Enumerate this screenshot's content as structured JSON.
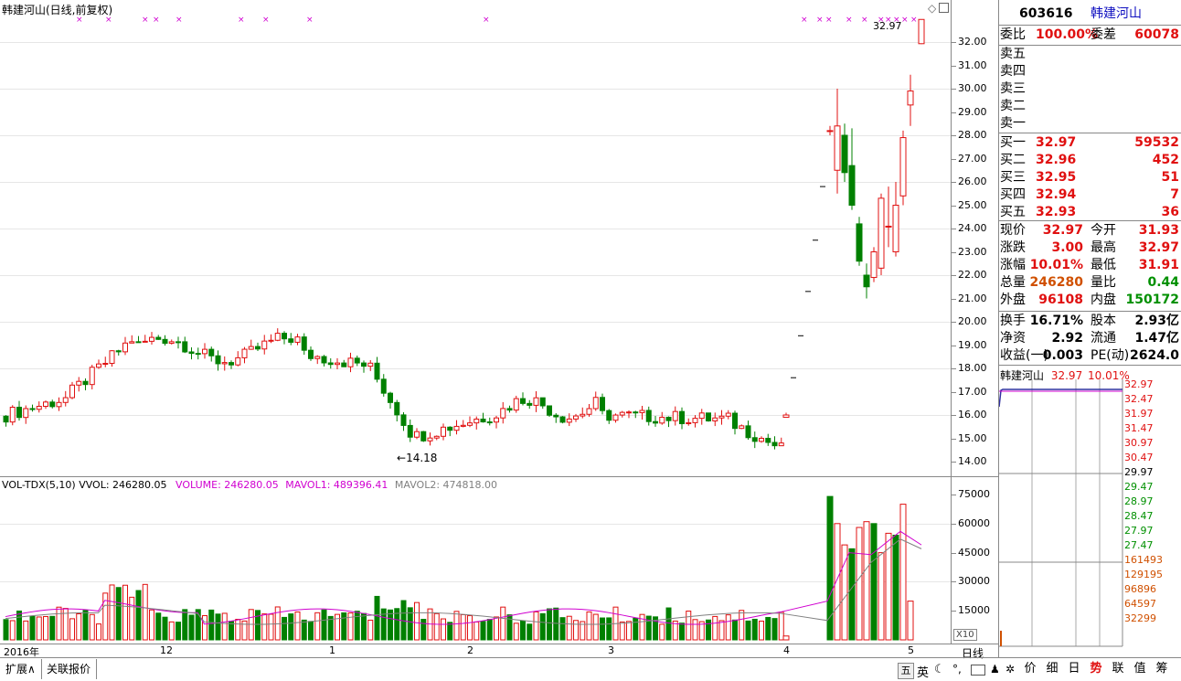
{
  "chart_header": {
    "title": "韩建河山(日线,前复权)",
    "last_price_label": "32.97",
    "low_marker": "14.18"
  },
  "price_axis": [
    "32.00",
    "31.00",
    "30.00",
    "29.00",
    "28.00",
    "27.00",
    "26.00",
    "25.00",
    "24.00",
    "23.00",
    "22.00",
    "21.00",
    "20.00",
    "19.00",
    "18.00",
    "17.00",
    "16.00",
    "15.00",
    "14.00"
  ],
  "volume_header": {
    "indicator": "VOL-TDX(5,10)",
    "vvol": "VVOL: 246280.05",
    "volume": "VOLUME: 246280.05",
    "mavol1": "MAVOL1: 489396.41",
    "mavol2": "MAVOL2: 474818.00"
  },
  "volume_axis": [
    "75000",
    "60000",
    "45000",
    "30000",
    "15000"
  ],
  "volume_unit": "X10",
  "time_axis": [
    "2016年",
    "12",
    "1",
    "2",
    "3",
    "4",
    "5"
  ],
  "period_label": "日线",
  "bottom_tabs": [
    "扩展∧",
    "关联报价"
  ],
  "quote": {
    "code": "603616",
    "name": "韩建河山",
    "weibi_label": "委比",
    "weibi_value": "100.00%",
    "weicha_label": "委差",
    "weicha_value": "60078",
    "sell_labels": [
      "卖五",
      "卖四",
      "卖三",
      "卖二",
      "卖一"
    ],
    "buy": [
      {
        "label": "买一",
        "price": "32.97",
        "vol": "59532"
      },
      {
        "label": "买二",
        "price": "32.96",
        "vol": "452"
      },
      {
        "label": "买三",
        "price": "32.95",
        "vol": "51"
      },
      {
        "label": "买四",
        "price": "32.94",
        "vol": "7"
      },
      {
        "label": "买五",
        "price": "32.93",
        "vol": "36"
      }
    ],
    "stats": [
      {
        "l1": "现价",
        "v1": "32.97",
        "l2": "今开",
        "v2": "31.93"
      },
      {
        "l1": "涨跌",
        "v1": "3.00",
        "l2": "最高",
        "v2": "32.97"
      },
      {
        "l1": "涨幅",
        "v1": "10.01%",
        "l2": "最低",
        "v2": "31.91"
      },
      {
        "l1": "总量",
        "v1": "246280",
        "l2": "量比",
        "v2": "0.44"
      },
      {
        "l1": "外盘",
        "v1": "96108",
        "l2": "内盘",
        "v2": "150172"
      }
    ],
    "stats2": [
      {
        "l1": "换手",
        "v1": "16.71%",
        "l2": "股本",
        "v2": "2.93亿"
      },
      {
        "l1": "净资",
        "v1": "2.92",
        "l2": "流通",
        "v2": "1.47亿"
      },
      {
        "l1": "收益(一)",
        "v1": "0.003",
        "l2": "PE(动)",
        "v2": "2624.0"
      }
    ]
  },
  "mini_chart": {
    "name": "韩建河山",
    "price": "32.97",
    "pct": "10.01%",
    "price_ticks": [
      "32.97",
      "32.47",
      "31.97",
      "31.47",
      "30.97",
      "30.47",
      "29.97",
      "29.47",
      "28.97",
      "28.47",
      "27.97",
      "27.47"
    ],
    "vol_ticks": [
      "161493",
      "129195",
      "96896",
      "64597",
      "32299"
    ]
  },
  "right_tabs": [
    "价",
    "细",
    "日",
    "势",
    "联",
    "值",
    "筹"
  ],
  "tray_icons": [
    "五",
    "英"
  ],
  "colors": {
    "up": "#e01010",
    "down": "#008000",
    "ma1": "#d000d0",
    "ma2": "#808080"
  },
  "chart_data": {
    "type": "candlestick",
    "title": "韩建河山(日线,前复权)",
    "ohlc_recent": [
      {
        "o": 15.9,
        "h": 16.1,
        "l": 15.9,
        "c": 16.0
      },
      {
        "o": 17.6,
        "h": 17.6,
        "l": 17.6,
        "c": 17.6
      },
      {
        "o": 19.4,
        "h": 19.4,
        "l": 19.4,
        "c": 19.4
      },
      {
        "o": 21.3,
        "h": 21.3,
        "l": 21.3,
        "c": 21.3
      },
      {
        "o": 23.5,
        "h": 23.5,
        "l": 23.5,
        "c": 23.5
      },
      {
        "o": 25.8,
        "h": 25.8,
        "l": 25.8,
        "c": 25.8
      },
      {
        "o": 28.2,
        "h": 28.4,
        "l": 28.0,
        "c": 28.2
      },
      {
        "o": 26.5,
        "h": 30.0,
        "l": 25.5,
        "c": 28.4
      },
      {
        "o": 28.0,
        "h": 28.5,
        "l": 26.0,
        "c": 26.4
      },
      {
        "o": 26.7,
        "h": 28.3,
        "l": 24.8,
        "c": 25.0
      },
      {
        "o": 24.2,
        "h": 24.5,
        "l": 22.4,
        "c": 22.6
      },
      {
        "o": 22.0,
        "h": 22.5,
        "l": 21.0,
        "c": 21.5
      },
      {
        "o": 21.9,
        "h": 23.2,
        "l": 21.7,
        "c": 23.0
      },
      {
        "o": 22.3,
        "h": 25.5,
        "l": 22.0,
        "c": 25.3
      },
      {
        "o": 24.1,
        "h": 25.8,
        "l": 23.2,
        "c": 24.1
      },
      {
        "o": 23.0,
        "h": 26.0,
        "l": 22.8,
        "c": 25.0
      },
      {
        "o": 25.4,
        "h": 28.2,
        "l": 25.0,
        "c": 27.9
      },
      {
        "o": 29.3,
        "h": 30.6,
        "l": 28.4,
        "c": 29.9
      },
      {
        "o": 31.93,
        "h": 32.97,
        "l": 31.91,
        "c": 32.97
      }
    ],
    "volume_recent": [
      2000,
      74000,
      60000,
      49000,
      47000,
      58000,
      61000,
      60000,
      45000,
      55000,
      54000,
      70000,
      20000
    ]
  }
}
